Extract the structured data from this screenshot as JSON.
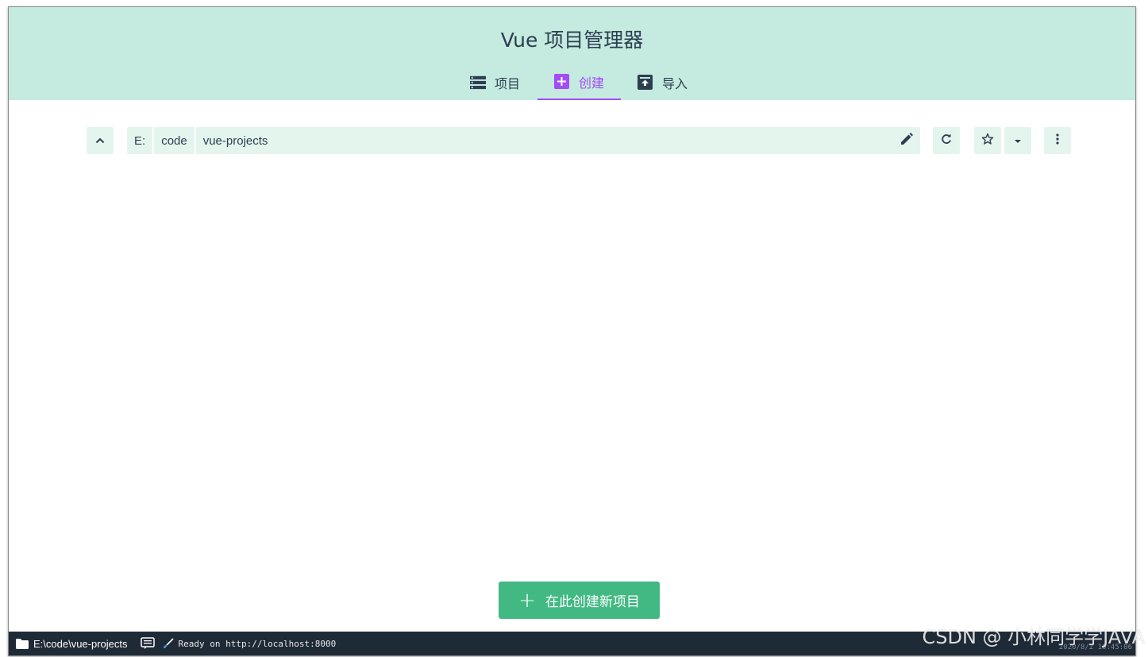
{
  "app": {
    "title": "Vue 项目管理器"
  },
  "tabs": [
    {
      "label": "项目",
      "icon": "list-icon"
    },
    {
      "label": "创建",
      "icon": "add-box-icon",
      "active": true
    },
    {
      "label": "导入",
      "icon": "unarchive-icon"
    }
  ],
  "path": {
    "segments": [
      "E:",
      "code",
      "vue-projects"
    ]
  },
  "actions": {
    "create_here": "在此创建新项目"
  },
  "status": {
    "cwd": "E:\\code\\vue-projects",
    "message": "Ready on http://localhost:8000",
    "time": "2020/8/2 16:45:06"
  },
  "watermark": "CSDN @ 小林同学学JAVA",
  "colors": {
    "header_bg": "#c5eadf",
    "accent": "#a44cf6",
    "primary": "#42b983",
    "statusbar": "#1f2a37"
  }
}
